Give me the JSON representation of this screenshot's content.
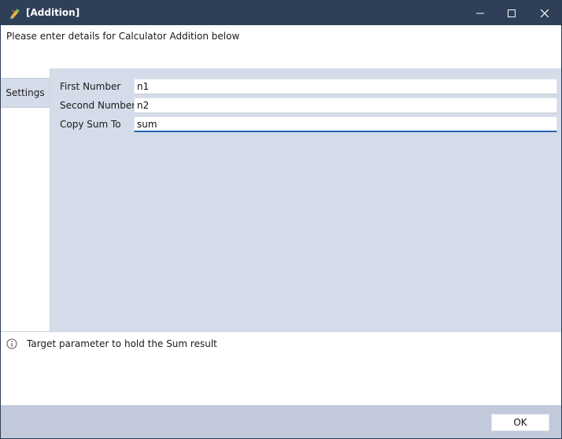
{
  "window": {
    "title": "[Addition]",
    "accent_color": "#2f3f57"
  },
  "header": {
    "text": "Please enter details for Calculator Addition below"
  },
  "sidebar": {
    "tabs": [
      {
        "label": "Settings",
        "selected": true
      }
    ]
  },
  "form": {
    "fields": [
      {
        "label": "First Number",
        "value": "n1"
      },
      {
        "label": "Second Number",
        "value": "n2"
      },
      {
        "label": "Copy Sum To",
        "value": "sum",
        "focused": true
      }
    ]
  },
  "info": {
    "icon": "info-icon",
    "text": "Target parameter to hold the Sum result"
  },
  "footer": {
    "ok_label": "OK"
  }
}
